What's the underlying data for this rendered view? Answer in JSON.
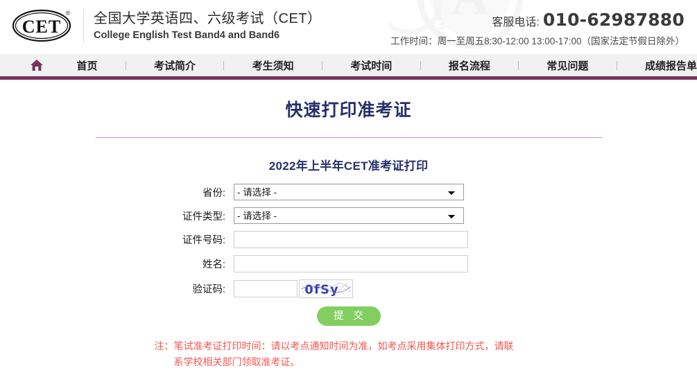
{
  "header": {
    "logo_text": "CET",
    "logo_reg_mark": "®",
    "brand_cn": "全国大学英语四、六级考试（CET）",
    "brand_en": "College English Test Band4 and Band6",
    "service_label": "客服电话:",
    "service_phone": "010-62987880",
    "work_hours": "工作时间：周一至周五8:30-12:00 13:00-17:00（国家法定节假日除外）"
  },
  "nav": {
    "home_icon": "home-icon",
    "items": [
      {
        "label": "首页"
      },
      {
        "label": "考试简介"
      },
      {
        "label": "考生须知"
      },
      {
        "label": "考试时间"
      },
      {
        "label": "报名流程"
      },
      {
        "label": "常见问题"
      },
      {
        "label": "成绩报告单"
      }
    ]
  },
  "page": {
    "title": "快速打印准考证"
  },
  "form": {
    "title": "2022年上半年CET准考证打印",
    "fields": {
      "province": {
        "label": "省份:",
        "value": "- 请选择 -",
        "options": [
          "- 请选择 -"
        ]
      },
      "id_type": {
        "label": "证件类型:",
        "value": "- 请选择 -",
        "options": [
          "- 请选择 -"
        ]
      },
      "id_number": {
        "label": "证件号码:",
        "value": "",
        "placeholder": ""
      },
      "name": {
        "label": "姓名:",
        "value": "",
        "placeholder": ""
      },
      "captcha": {
        "label": "验证码:",
        "value": "",
        "placeholder": "",
        "image_text": "0fSy"
      }
    },
    "submit_label": "提 交"
  },
  "note": {
    "line1": "注：笔试准考证打印时间：请以考点通知时间为准，如考点采用集体打印方式，请联",
    "line2": "系学校相关部门领取准考证。"
  },
  "colors": {
    "nav_accent": "#7a3060",
    "title_navy": "#27306b",
    "rule_pink": "#cf8fc4",
    "submit_green": "#82ce60",
    "note_red": "#f4574f"
  }
}
